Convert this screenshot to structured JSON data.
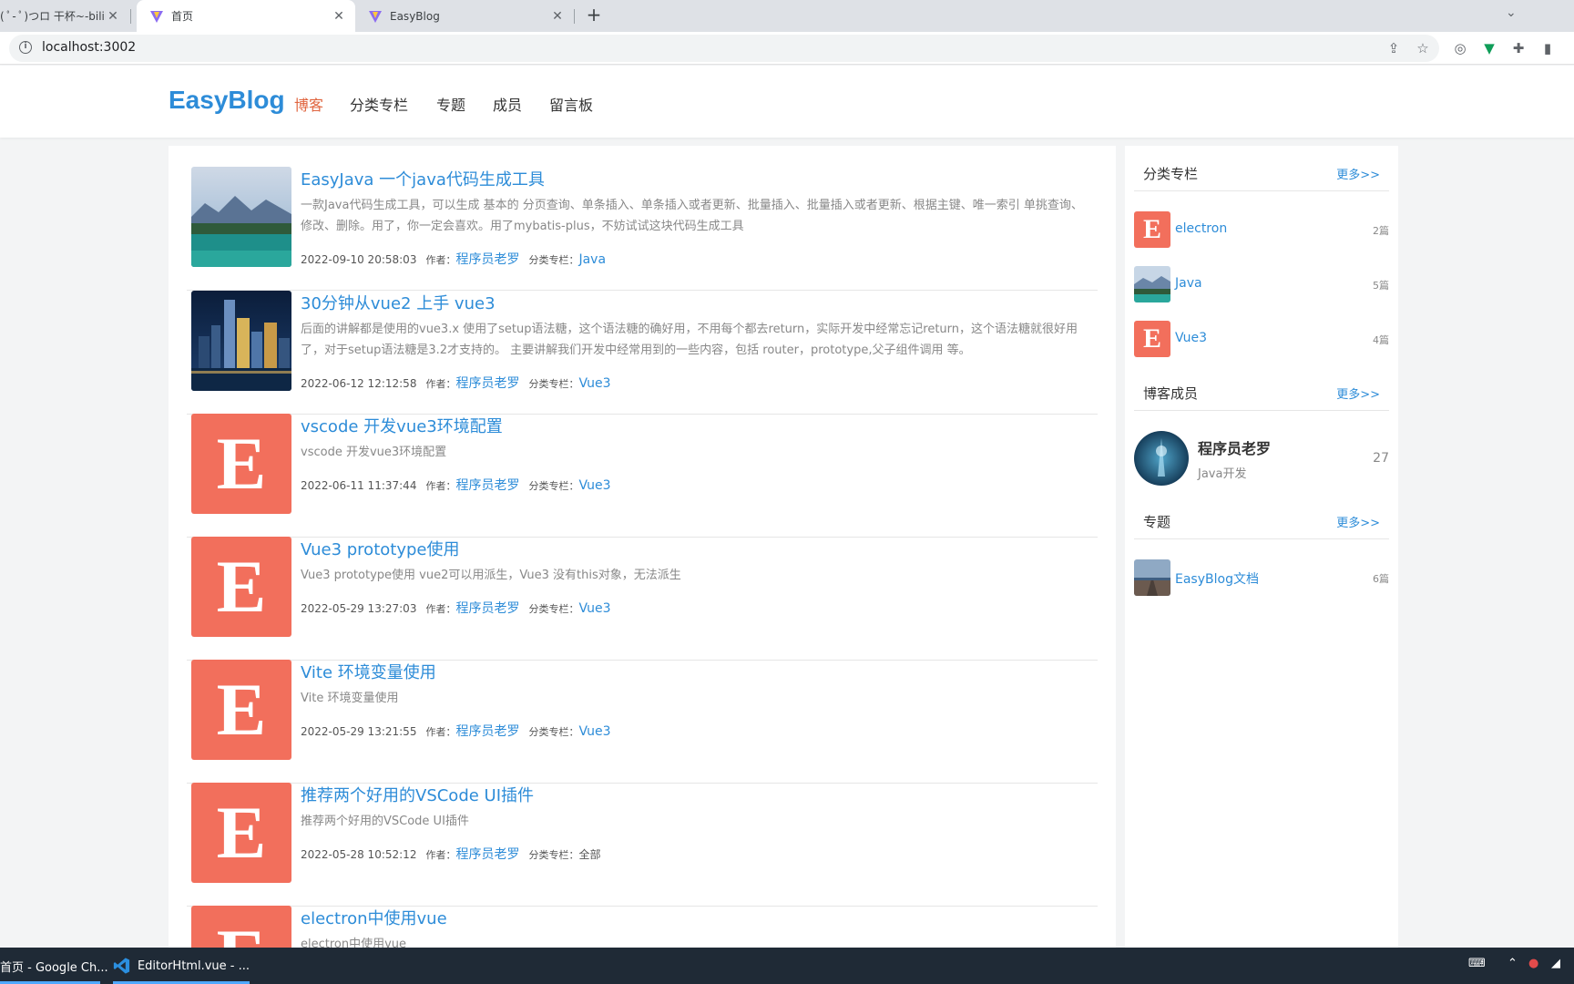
{
  "browser": {
    "tabs": [
      {
        "title": "( ﾟ- ﾟ)つロ 干杯~-bilibili",
        "active": false
      },
      {
        "title": "首页",
        "active": true
      },
      {
        "title": "EasyBlog",
        "active": false
      }
    ],
    "url": "localhost:3002"
  },
  "header": {
    "logo": "EasyBlog",
    "nav": [
      "博客",
      "分类专栏",
      "专题",
      "成员",
      "留言板"
    ]
  },
  "labels": {
    "author": "作者：",
    "category": "分类专栏："
  },
  "articles": [
    {
      "title": "EasyJava 一个java代码生成工具",
      "summary": "一款Java代码生成工具，可以生成 基本的 分页查询、单条插入、单条插入或者更新、批量插入、批量插入或者更新、根据主键、唯一索引 单挑查询、修改、删除。用了，你一定会喜欢。用了mybatis-plus，不妨试试这块代码生成工具",
      "date": "2022-09-10 20:58:03",
      "author": "程序员老罗",
      "category": "Java",
      "thumb": "landscape"
    },
    {
      "title": "30分钟从vue2 上手 vue3",
      "summary": "后面的讲解都是使用的vue3.x 使用了setup语法糖，这个语法糖的确好用，不用每个都去return，实际开发中经常忘记return，这个语法糖就很好用了，对于setup语法糖是3.2才支持的。 主要讲解我们开发中经常用到的一些内容，包括 router，prototype,父子组件调用 等。",
      "date": "2022-06-12 12:12:58",
      "author": "程序员老罗",
      "category": "Vue3",
      "thumb": "city"
    },
    {
      "title": "vscode 开发vue3环境配置",
      "summary": "vscode 开发vue3环境配置",
      "date": "2022-06-11 11:37:44",
      "author": "程序员老罗",
      "category": "Vue3",
      "thumb": "E"
    },
    {
      "title": "Vue3 prototype使用",
      "summary": "Vue3 prototype使用 vue2可以用派生，Vue3 没有this对象，无法派生",
      "date": "2022-05-29 13:27:03",
      "author": "程序员老罗",
      "category": "Vue3",
      "thumb": "E"
    },
    {
      "title": "Vite 环境变量使用",
      "summary": "Vite 环境变量使用",
      "date": "2022-05-29 13:21:55",
      "author": "程序员老罗",
      "category": "Vue3",
      "thumb": "E"
    },
    {
      "title": "推荐两个好用的VSCode UI插件",
      "summary": "推荐两个好用的VSCode UI插件",
      "date": "2022-05-28 10:52:12",
      "author": "程序员老罗",
      "category": "全部",
      "thumb": "E"
    },
    {
      "title": "electron中使用vue",
      "summary": "electron中使用vue",
      "thumb": "E"
    }
  ],
  "sidebar": {
    "categories": {
      "title": "分类专栏",
      "more": "更多>>",
      "items": [
        {
          "name": "electron",
          "count": "2篇",
          "icon": "E"
        },
        {
          "name": "Java",
          "count": "5篇",
          "icon": "landscape"
        },
        {
          "name": "Vue3",
          "count": "4篇",
          "icon": "E"
        }
      ]
    },
    "members": {
      "title": "博客成员",
      "more": "更多>>",
      "items": [
        {
          "name": "程序员老罗",
          "desc": "Java开发",
          "count": "27"
        }
      ]
    },
    "topics": {
      "title": "专题",
      "more": "更多>>",
      "items": [
        {
          "name": "EasyBlog文档",
          "count": "6篇",
          "icon": "road"
        }
      ]
    }
  },
  "taskbar": {
    "items": [
      "首页 - Google Ch...",
      "EditorHtml.vue - ..."
    ]
  },
  "colors": {
    "accent": "#2d8cd8",
    "nav_active": "#e0653f",
    "thumb_e": "#f26f5c"
  }
}
